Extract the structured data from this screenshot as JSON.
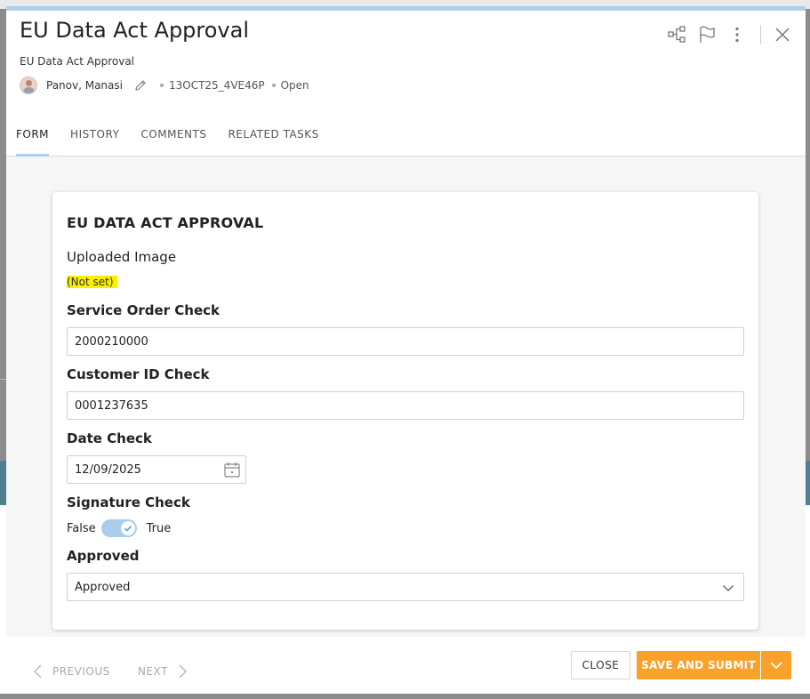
{
  "header": {
    "title": "EU Data Act Approval",
    "subtitle": "EU Data Act Approval",
    "owner": "Panov, Manasi",
    "task_id": "13OCT25_4VE46P",
    "status": "Open"
  },
  "tabs": [
    {
      "label": "FORM",
      "active": true
    },
    {
      "label": "HISTORY",
      "active": false
    },
    {
      "label": "COMMENTS",
      "active": false
    },
    {
      "label": "RELATED TASKS",
      "active": false
    }
  ],
  "form": {
    "title": "EU DATA ACT APPROVAL",
    "uploaded_image": {
      "label": "Uploaded Image",
      "value": "(Not set)"
    },
    "service_order": {
      "label": "Service Order Check",
      "value": "2000210000"
    },
    "customer_id": {
      "label": "Customer ID Check",
      "value": "0001237635"
    },
    "date_check": {
      "label": "Date Check",
      "value": "12/09/2025"
    },
    "signature_check": {
      "label": "Signature Check",
      "false_label": "False",
      "true_label": "True",
      "value": true
    },
    "approved": {
      "label": "Approved",
      "value": "Approved"
    }
  },
  "footer": {
    "previous": "PREVIOUS",
    "next": "NEXT",
    "close": "CLOSE",
    "submit": "SAVE AND SUBMIT"
  },
  "icons": {
    "header": [
      "workflow-icon",
      "flag-icon",
      "more-vertical-icon",
      "close-icon"
    ],
    "owner_edit": "pencil-icon",
    "date": "calendar-icon",
    "select": "chevron-down-icon"
  },
  "colors": {
    "accent": "#aed0ea",
    "primary_button": "#f9a12a",
    "highlight": "#f8f000"
  }
}
